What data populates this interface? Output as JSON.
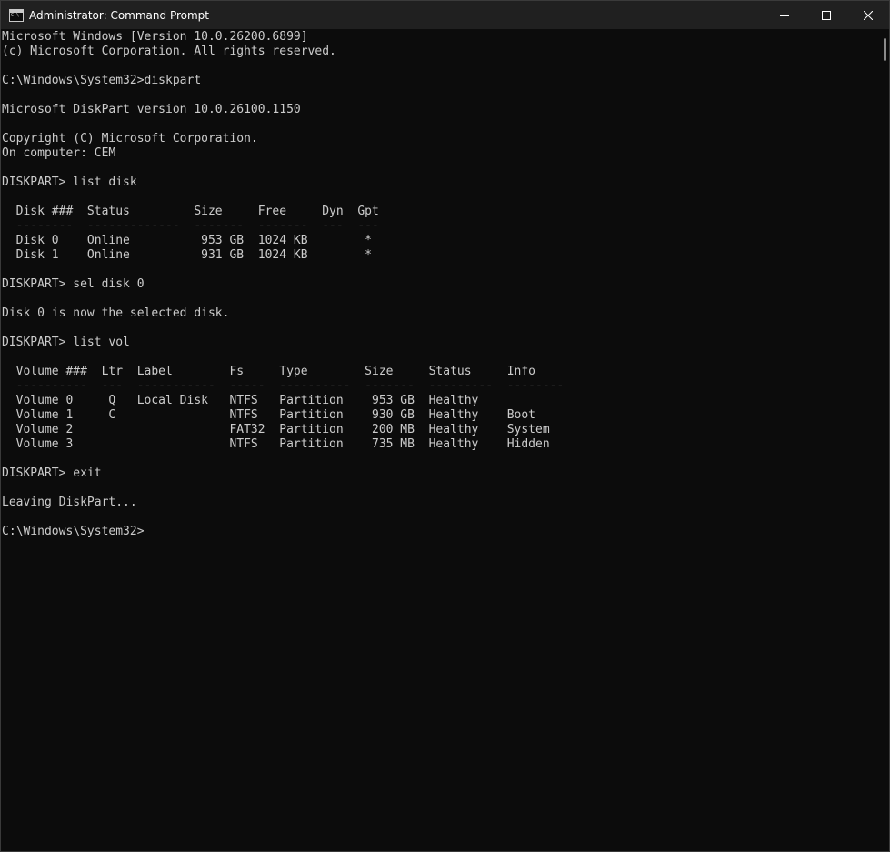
{
  "window": {
    "title": "Administrator: Command Prompt",
    "icon": "command-prompt-icon"
  },
  "controls": {
    "minimize_icon": "minimize-icon",
    "maximize_icon": "maximize-icon",
    "close_icon": "close-icon"
  },
  "console": {
    "lines": [
      "Microsoft Windows [Version 10.0.26200.6899]",
      "(c) Microsoft Corporation. All rights reserved.",
      "",
      "C:\\Windows\\System32>diskpart",
      "",
      "Microsoft DiskPart version 10.0.26100.1150",
      "",
      "Copyright (C) Microsoft Corporation.",
      "On computer: CEM",
      "",
      "DISKPART> list disk",
      "",
      "  Disk ###  Status         Size     Free     Dyn  Gpt",
      "  --------  -------------  -------  -------  ---  ---",
      "  Disk 0    Online          953 GB  1024 KB        *",
      "  Disk 1    Online          931 GB  1024 KB        *",
      "",
      "DISKPART> sel disk 0",
      "",
      "Disk 0 is now the selected disk.",
      "",
      "DISKPART> list vol",
      "",
      "  Volume ###  Ltr  Label        Fs     Type        Size     Status     Info",
      "  ----------  ---  -----------  -----  ----------  -------  ---------  --------",
      "  Volume 0     Q   Local Disk   NTFS   Partition    953 GB  Healthy",
      "  Volume 1     C                NTFS   Partition    930 GB  Healthy    Boot",
      "  Volume 2                      FAT32  Partition    200 MB  Healthy    System",
      "  Volume 3                      NTFS   Partition    735 MB  Healthy    Hidden",
      "",
      "DISKPART> exit",
      "",
      "Leaving DiskPart...",
      "",
      "C:\\Windows\\System32>"
    ]
  }
}
